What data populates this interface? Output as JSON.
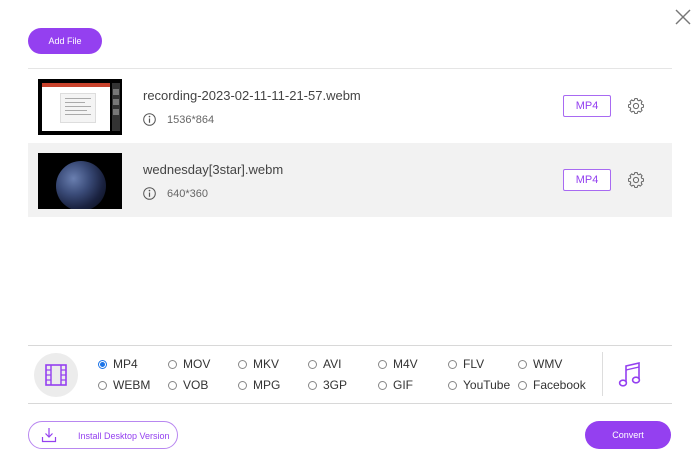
{
  "toolbar": {
    "add_file_label": "Add File"
  },
  "files": [
    {
      "name": "recording-2023-02-11-11-21-57.webm",
      "resolution": "1536*864",
      "format": "MP4",
      "thumbnail": "screen-recording"
    },
    {
      "name": "wednesday[3star].webm",
      "resolution": "640*360",
      "format": "MP4",
      "thumbnail": "earth-at-night"
    }
  ],
  "formats": {
    "row1": [
      {
        "label": "MP4",
        "checked": true
      },
      {
        "label": "MOV",
        "checked": false
      },
      {
        "label": "MKV",
        "checked": false
      },
      {
        "label": "AVI",
        "checked": false
      },
      {
        "label": "M4V",
        "checked": false
      },
      {
        "label": "FLV",
        "checked": false
      },
      {
        "label": "WMV",
        "checked": false
      }
    ],
    "row2": [
      {
        "label": "WEBM",
        "checked": false
      },
      {
        "label": "VOB",
        "checked": false
      },
      {
        "label": "MPG",
        "checked": false
      },
      {
        "label": "3GP",
        "checked": false
      },
      {
        "label": "GIF",
        "checked": false
      },
      {
        "label": "YouTube",
        "checked": false
      },
      {
        "label": "Facebook",
        "checked": false
      }
    ]
  },
  "footer": {
    "install_label": "Install Desktop Version",
    "convert_label": "Convert"
  },
  "icons": {
    "close": "close-icon",
    "info": "info-icon",
    "gear": "gear-icon",
    "video": "film-icon",
    "audio": "music-note-icon",
    "download": "download-icon"
  },
  "colors": {
    "accent": "#9440f0",
    "radio_selected": "#1a73e8",
    "row_alt_bg": "#f2f2f2"
  }
}
